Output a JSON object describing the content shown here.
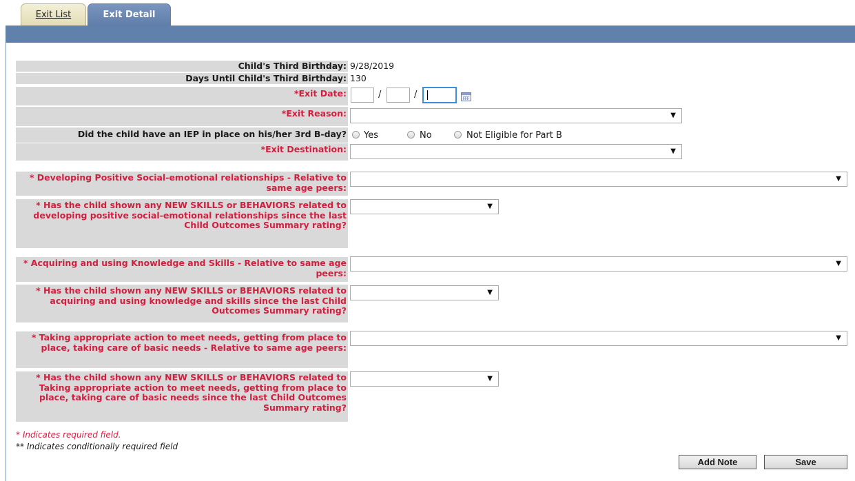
{
  "tabs": [
    {
      "label": "Exit List",
      "active": false
    },
    {
      "label": "Exit Detail",
      "active": true
    }
  ],
  "fields": {
    "third_birthday": {
      "label": "Child's Third Birthday:",
      "value": "9/28/2019"
    },
    "days_until": {
      "label": "Days Until Child's Third Birthday:",
      "value": "130"
    },
    "exit_date": {
      "label": "*Exit Date:",
      "month": "",
      "day": "",
      "year": "",
      "separator": "/"
    },
    "exit_reason": {
      "label": "*Exit Reason:",
      "value": ""
    },
    "iep": {
      "label": "Did the child have an IEP in place on his/her 3rd B-day?",
      "options": [
        "Yes",
        "No",
        "Not Eligible for Part B"
      ]
    },
    "exit_destination": {
      "label": "*Exit Destination:",
      "value": ""
    },
    "social_rel": {
      "label": "* Developing Positive Social-emotional relationships - Relative to same age peers:",
      "value": ""
    },
    "social_new": {
      "label": "* Has the child shown any NEW SKILLS or BEHAVIORS related to developing positive social-emotional relationships since the last Child Outcomes Summary rating?",
      "value": ""
    },
    "knowledge_rel": {
      "label": "* Acquiring and using Knowledge and Skills - Relative to same age peers:",
      "value": ""
    },
    "knowledge_new": {
      "label": "* Has the child shown any NEW SKILLS or BEHAVIORS related to acquiring and using knowledge and skills since the last Child Outcomes Summary rating?",
      "value": ""
    },
    "action_rel": {
      "label": "* Taking appropriate action to meet needs, getting from place to place, taking care of basic needs - Relative to same age peers:",
      "value": ""
    },
    "action_new": {
      "label": "* Has the child shown any NEW SKILLS or BEHAVIORS related to Taking appropriate action to meet needs, getting from place to place, taking care of basic needs since the last Child Outcomes Summary rating?",
      "value": ""
    }
  },
  "footnotes": {
    "required": "* Indicates required field.",
    "conditional": "** Indicates conditionally required field"
  },
  "buttons": {
    "add_note": "Add Note",
    "save": "Save"
  },
  "icons": {
    "dropdown": "▼",
    "calendar": "calendar-icon"
  },
  "colors": {
    "header_bar": "#6181ad",
    "label_bg": "#d9d9d9",
    "required_text": "#d31f3f",
    "focus_border": "#3d8ed8"
  }
}
